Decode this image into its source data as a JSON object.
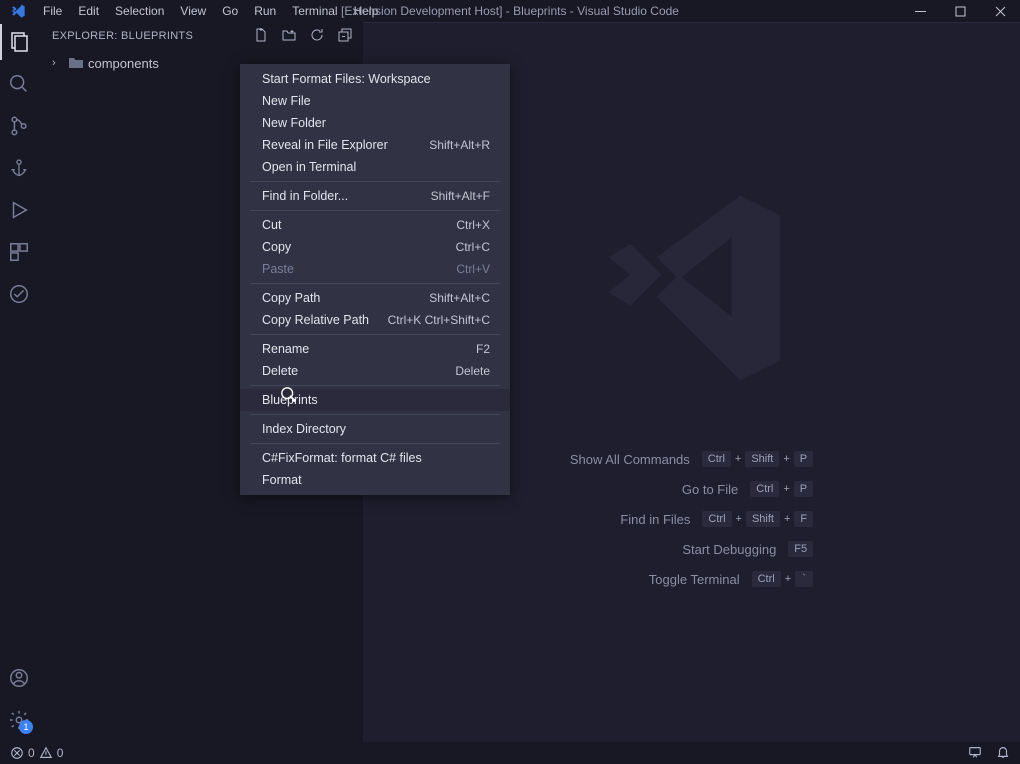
{
  "title": "[Extension Development Host] - Blueprints - Visual Studio Code",
  "menu": [
    "File",
    "Edit",
    "Selection",
    "View",
    "Go",
    "Run",
    "Terminal",
    "Help"
  ],
  "sidebar": {
    "title": "EXPLORER: BLUEPRINTS",
    "tree": [
      {
        "label": "components",
        "type": "folder"
      }
    ]
  },
  "contextMenu": {
    "groups": [
      [
        {
          "label": "Start Format Files: Workspace"
        },
        {
          "label": "New File"
        },
        {
          "label": "New Folder"
        },
        {
          "label": "Reveal in File Explorer",
          "shortcut": "Shift+Alt+R"
        },
        {
          "label": "Open in Terminal"
        }
      ],
      [
        {
          "label": "Find in Folder...",
          "shortcut": "Shift+Alt+F"
        }
      ],
      [
        {
          "label": "Cut",
          "shortcut": "Ctrl+X"
        },
        {
          "label": "Copy",
          "shortcut": "Ctrl+C"
        },
        {
          "label": "Paste",
          "shortcut": "Ctrl+V",
          "disabled": true
        }
      ],
      [
        {
          "label": "Copy Path",
          "shortcut": "Shift+Alt+C"
        },
        {
          "label": "Copy Relative Path",
          "shortcut": "Ctrl+K Ctrl+Shift+C"
        }
      ],
      [
        {
          "label": "Rename",
          "shortcut": "F2"
        },
        {
          "label": "Delete",
          "shortcut": "Delete"
        }
      ],
      [
        {
          "label": "Blueprints",
          "hovered": true
        }
      ],
      [
        {
          "label": "Index Directory"
        }
      ],
      [
        {
          "label": "C#FixFormat: format C# files"
        },
        {
          "label": "Format"
        }
      ]
    ]
  },
  "welcome": [
    {
      "label": "Show All Commands",
      "keys": [
        "Ctrl",
        "Shift",
        "P"
      ]
    },
    {
      "label": "Go to File",
      "keys": [
        "Ctrl",
        "P"
      ]
    },
    {
      "label": "Find in Files",
      "keys": [
        "Ctrl",
        "Shift",
        "F"
      ]
    },
    {
      "label": "Start Debugging",
      "keys": [
        "F5"
      ]
    },
    {
      "label": "Toggle Terminal",
      "keys": [
        "Ctrl",
        "`"
      ]
    }
  ],
  "status": {
    "errors": "0",
    "warnings": "0"
  },
  "settingsBadge": "1"
}
